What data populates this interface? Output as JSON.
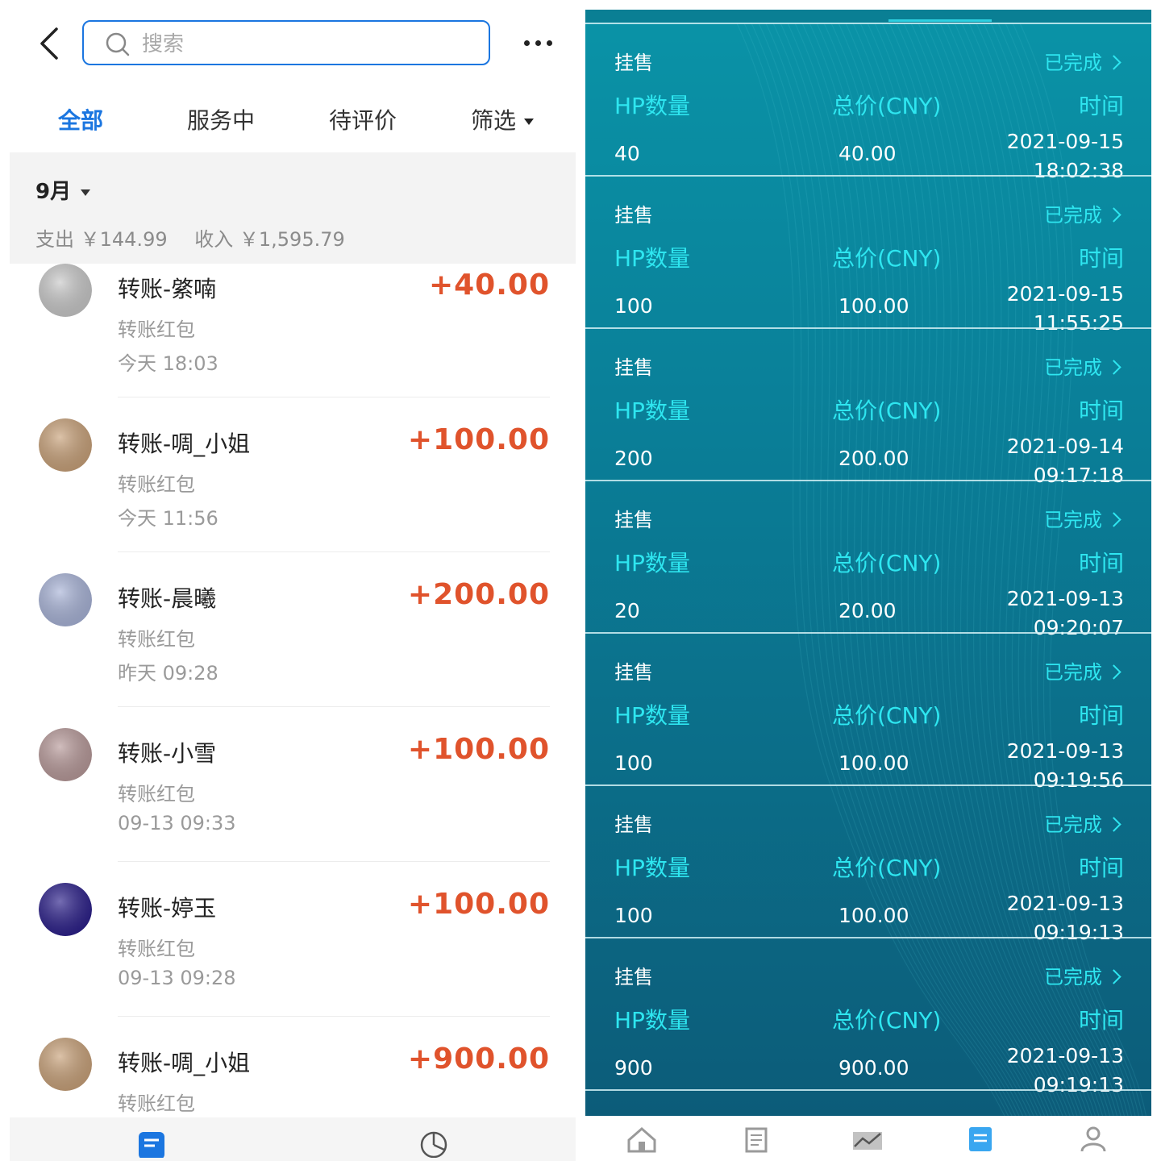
{
  "left": {
    "search": {
      "placeholder": "搜索"
    },
    "tabs": [
      {
        "label": "全部",
        "active": true
      },
      {
        "label": "服务中",
        "active": false
      },
      {
        "label": "待评价",
        "active": false
      },
      {
        "label": "筛选",
        "active": false
      }
    ],
    "month": {
      "label": "9月",
      "expense": "支出 ￥144.99",
      "income": "收入 ￥1,595.79"
    },
    "transactions": [
      {
        "title": "转账-綮喃",
        "subtitle": "转账红包",
        "time": "今天  18:03",
        "amount": "+40.00",
        "avatar_color": "#c9c9c9"
      },
      {
        "title": "转账-啁_小姐",
        "subtitle": "转账红包",
        "time": "今天  11:56",
        "amount": "+100.00",
        "avatar_color": "#c9a27a"
      },
      {
        "title": "转账-晨曦",
        "subtitle": "转账红包",
        "time": "昨天  09:28",
        "amount": "+200.00",
        "avatar_color": "#a9b4d8"
      },
      {
        "title": "转账-小雪",
        "subtitle": "转账红包",
        "time": "09-13  09:33",
        "amount": "+100.00",
        "avatar_color": "#b89a9a"
      },
      {
        "title": "转账-婷玉",
        "subtitle": "转账红包",
        "time": "09-13  09:28",
        "amount": "+100.00",
        "avatar_color": "#2b1f8a"
      },
      {
        "title": "转账-啁_小姐",
        "subtitle": "转账红包",
        "time": "",
        "amount": "+900.00",
        "avatar_color": "#c9a27a"
      }
    ],
    "bottom_nav": [
      {
        "icon": "bill-list-icon",
        "color": "#1b76e0"
      },
      {
        "icon": "pie-chart-icon",
        "color": "#555555"
      }
    ]
  },
  "right": {
    "labels": {
      "qty": "HP数量",
      "price": "总价(CNY)",
      "time": "时间"
    },
    "records": [
      {
        "type": "挂售",
        "status": "已完成",
        "qty": "40",
        "price": "40.00",
        "date": "2021-09-15",
        "clock": "18:02:38"
      },
      {
        "type": "挂售",
        "status": "已完成",
        "qty": "100",
        "price": "100.00",
        "date": "2021-09-15",
        "clock": "11:55:25"
      },
      {
        "type": "挂售",
        "status": "已完成",
        "qty": "200",
        "price": "200.00",
        "date": "2021-09-14",
        "clock": "09:17:18"
      },
      {
        "type": "挂售",
        "status": "已完成",
        "qty": "20",
        "price": "20.00",
        "date": "2021-09-13",
        "clock": "09:20:07"
      },
      {
        "type": "挂售",
        "status": "已完成",
        "qty": "100",
        "price": "100.00",
        "date": "2021-09-13",
        "clock": "09:19:56"
      },
      {
        "type": "挂售",
        "status": "已完成",
        "qty": "100",
        "price": "100.00",
        "date": "2021-09-13",
        "clock": "09:19:13"
      },
      {
        "type": "挂售",
        "status": "已完成",
        "qty": "900",
        "price": "900.00",
        "date": "2021-09-13",
        "clock": "09:19:13"
      }
    ],
    "bottom_nav": [
      {
        "icon": "home-icon",
        "active": false
      },
      {
        "icon": "document-icon",
        "active": false
      },
      {
        "icon": "chart-icon",
        "active": false
      },
      {
        "icon": "orders-icon",
        "active": true
      },
      {
        "icon": "user-icon",
        "active": false
      }
    ],
    "colors": {
      "accent": "#2ee6f0",
      "background": "#0a8099"
    }
  }
}
